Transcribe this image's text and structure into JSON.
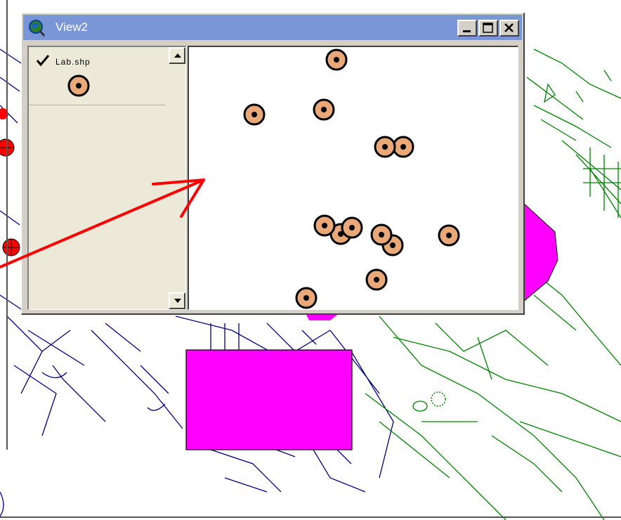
{
  "window": {
    "title": "View2",
    "app_icon": "globe-magnifier-icon",
    "controls": [
      "minimize-icon",
      "maximize-icon",
      "close-icon"
    ]
  },
  "toc": {
    "layers": [
      {
        "name": "Lab.shp",
        "visible": true,
        "symbol": "circle-dot-icon",
        "fill_color": "#e8a878",
        "dot_color": "#000000"
      }
    ]
  },
  "colors": {
    "titlebar": "#7b96d6",
    "annotation_arrow": "#ff0000",
    "polygon": "#ff00ff",
    "roads_blue": "#000080",
    "roads_green": "#008000"
  }
}
